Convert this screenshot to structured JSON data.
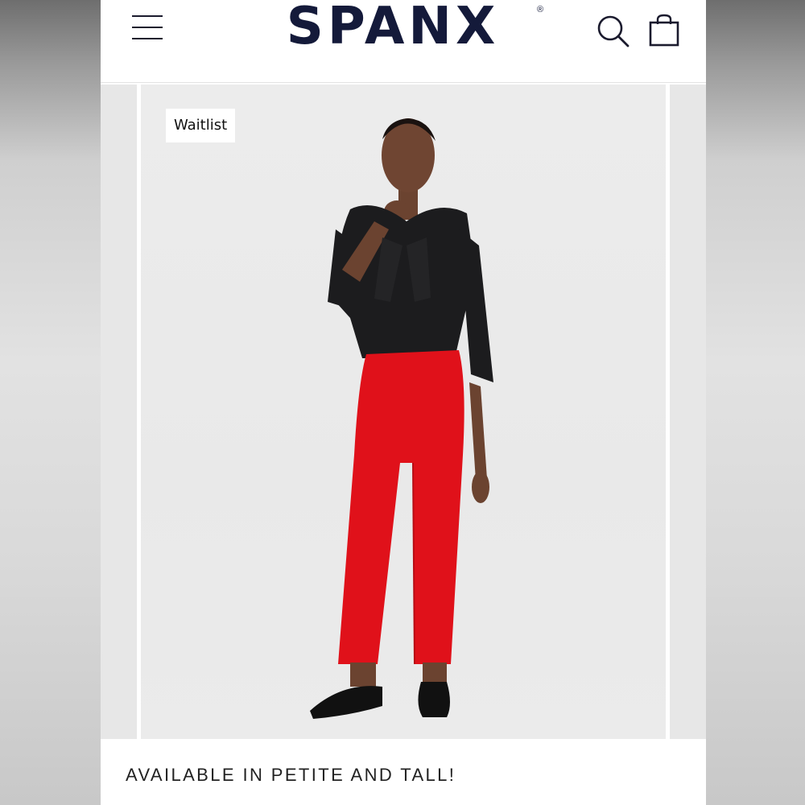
{
  "header": {
    "brand": "SPANX",
    "brand_mark": "®",
    "menu_icon": "hamburger-menu-icon",
    "search_icon": "search-icon",
    "cart_icon": "shopping-bag-icon",
    "brand_color": "#141a3a"
  },
  "product": {
    "badge": "Waitlist",
    "image": "model-red-pants-photo",
    "pants_color": "#e0111a",
    "top_color": "#1c1c1e"
  },
  "promo": {
    "text": "AVAILABLE IN PETITE AND TALL!"
  }
}
